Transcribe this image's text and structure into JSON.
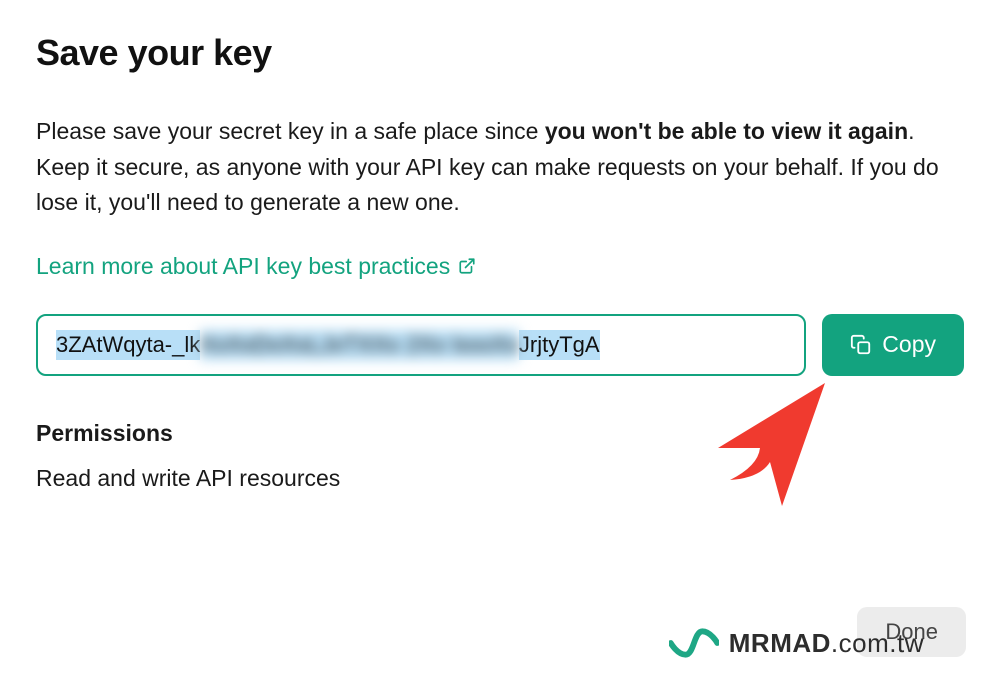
{
  "title": "Save your key",
  "description": {
    "part1": "Please save your secret key in a safe place since ",
    "bold": "you won't be able to view it again",
    "part2": ". Keep it secure, as anyone with your API key can make requests on your behalf. If you do lose it, you'll need to generate a new one."
  },
  "learn_more": "Learn more about API key best practices",
  "api_key": {
    "prefix": "3ZAtWqyta-_lk",
    "obscured": "XxXxDxXxLJxTXXx 2Xx lxxxXx",
    "suffix": "JrjtyTgA"
  },
  "copy_label": "Copy",
  "permissions": {
    "heading": "Permissions",
    "value": "Read and write API resources"
  },
  "done_label": "Done",
  "watermark": {
    "brand": "MRMAD",
    "domain": ".com.tw"
  },
  "colors": {
    "accent": "#13a37f",
    "annotation": "#f03a2f"
  }
}
